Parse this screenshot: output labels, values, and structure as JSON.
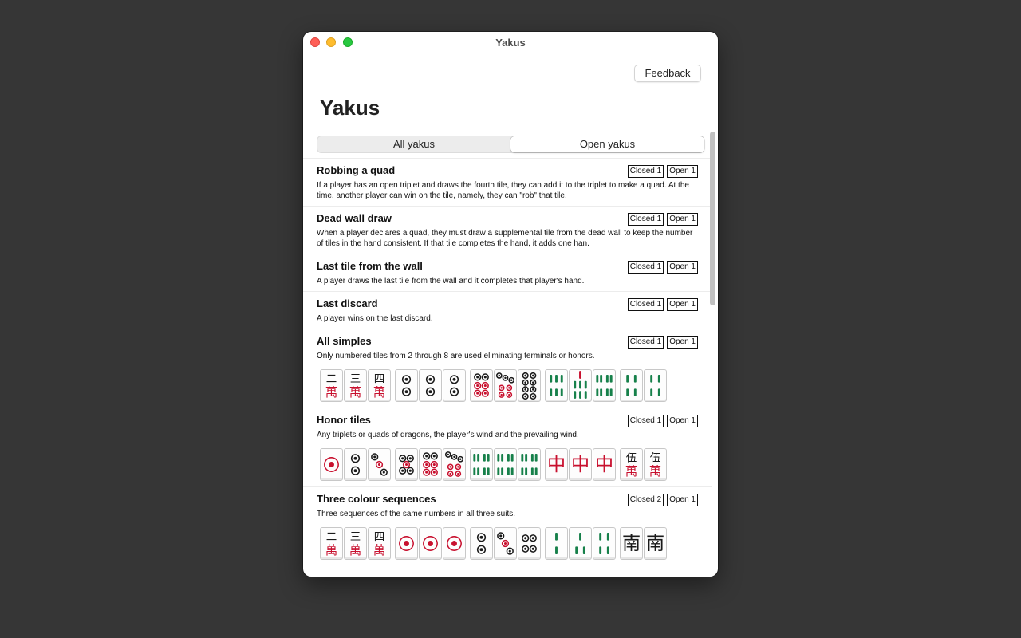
{
  "window": {
    "title": "Yakus"
  },
  "toolbar": {
    "feedback_label": "Feedback"
  },
  "page": {
    "title": "Yakus"
  },
  "tabs": [
    {
      "label": "All yakus",
      "selected": false
    },
    {
      "label": "Open yakus",
      "selected": true
    }
  ],
  "yakus": [
    {
      "name": "Robbing a quad",
      "closed": "Closed 1",
      "open": "Open 1",
      "description": "If a player has an open triplet and draws the fourth tile, they can add it to the triplet to make a quad. At the time, another player can win on the tile, namely, they can \"rob\" that tile.",
      "tiles": []
    },
    {
      "name": "Dead wall draw",
      "closed": "Closed 1",
      "open": "Open 1",
      "description": "When a player declares a quad, they must draw a supplemental tile from the dead wall to keep the number of tiles in the hand consistent. If that tile completes the hand, it adds one han.",
      "tiles": []
    },
    {
      "name": "Last tile from the wall",
      "closed": "Closed 1",
      "open": "Open 1",
      "description": "A player draws the last tile from the wall and it completes that player's hand.",
      "tiles": []
    },
    {
      "name": "Last discard",
      "closed": "Closed 1",
      "open": "Open 1",
      "description": "A player wins on the last discard.",
      "tiles": []
    },
    {
      "name": "All simples",
      "closed": "Closed 1",
      "open": "Open 1",
      "description": "Only numbered tiles from 2 through 8 are used eliminating terminals or honors.",
      "tiles": [
        [
          "2m",
          "3m",
          "4m"
        ],
        [
          "2p",
          "2p",
          "2p"
        ],
        [
          "6p",
          "7p",
          "8p"
        ],
        [
          "6s",
          "7s",
          "8s"
        ],
        [
          "4s",
          "4s"
        ]
      ]
    },
    {
      "name": "Honor tiles",
      "closed": "Closed 1",
      "open": "Open 1",
      "description": "Any triplets or quads of dragons, the player's wind and the prevailing wind.",
      "tiles": [
        [
          "1p",
          "2p",
          "3p"
        ],
        [
          "5p",
          "6p",
          "7p"
        ],
        [
          "8s",
          "8s",
          "8s"
        ],
        [
          "red",
          "red",
          "red"
        ],
        [
          "5m",
          "5m"
        ]
      ]
    },
    {
      "name": "Three colour sequences",
      "closed": "Closed 2",
      "open": "Open 1",
      "description": "Three sequences of the same numbers in all three suits.",
      "tiles": [
        [
          "2m",
          "3m",
          "4m"
        ],
        [
          "1p",
          "1p",
          "1p"
        ],
        [
          "2p",
          "3p",
          "4p"
        ],
        [
          "2s",
          "3s",
          "4s"
        ],
        [
          "south",
          "south"
        ]
      ]
    }
  ]
}
